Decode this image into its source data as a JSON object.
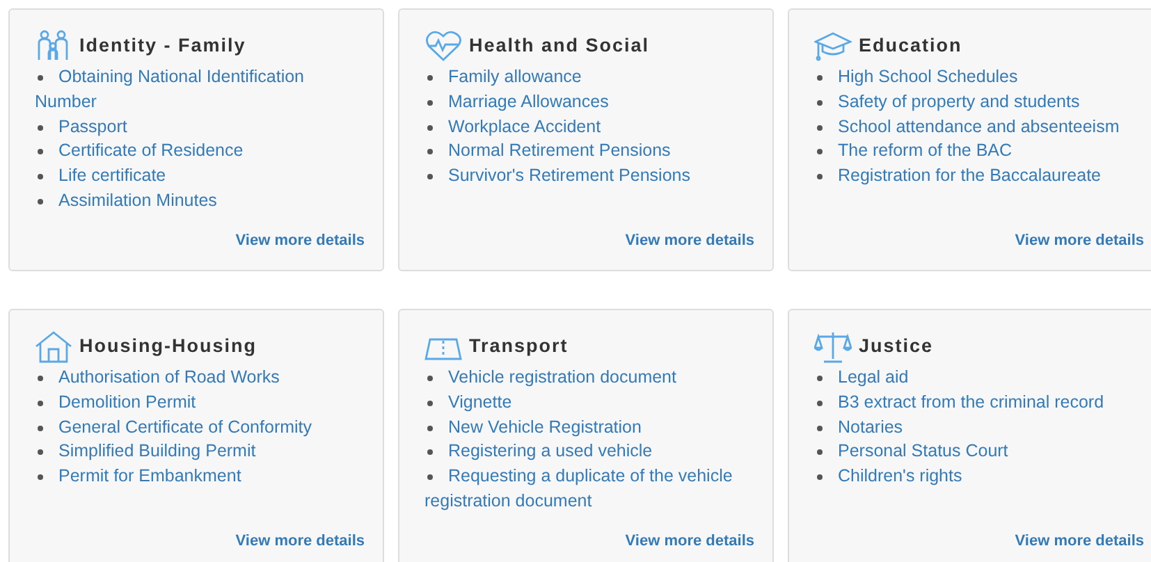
{
  "categories": [
    {
      "title": "Identity - Family",
      "items": [
        "Obtaining National Identification Number",
        "Passport",
        "Certificate of Residence",
        "Life certificate",
        "Assimilation Minutes"
      ],
      "more": "View more details"
    },
    {
      "title": "Health and Social",
      "items": [
        "Family allowance",
        "Marriage Allowances",
        "Workplace Accident",
        "Normal Retirement Pensions",
        "Survivor's Retirement Pensions"
      ],
      "more": "View more details"
    },
    {
      "title": "Education",
      "items": [
        "High School Schedules",
        "Safety of property and students",
        "School attendance and absenteeism",
        "The reform of the BAC",
        "Registration for the Baccalaureate"
      ],
      "more": "View more details"
    },
    {
      "title": "Housing-Housing",
      "items": [
        "Authorisation of Road Works",
        "Demolition Permit",
        "General Certificate of Conformity",
        "Simplified Building Permit",
        "Permit for Embankment"
      ],
      "more": "View more details"
    },
    {
      "title": "Transport",
      "items": [
        "Vehicle registration document",
        "Vignette",
        "New Vehicle Registration",
        "Registering a used vehicle",
        "Requesting a duplicate of the vehicle registration document"
      ],
      "more": "View more details"
    },
    {
      "title": "Justice",
      "items": [
        "Legal aid",
        "B3 extract from the criminal record",
        "Notaries",
        "Personal Status Court",
        "Children's rights"
      ],
      "more": "View more details"
    }
  ]
}
